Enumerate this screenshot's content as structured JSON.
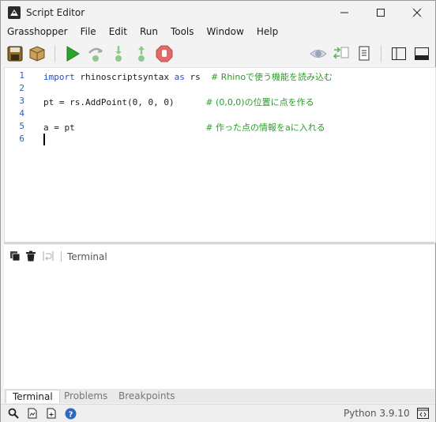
{
  "window": {
    "title": "Script Editor"
  },
  "menu": [
    "Grasshopper",
    "File",
    "Edit",
    "Run",
    "Tools",
    "Window",
    "Help"
  ],
  "editor": {
    "lines": [
      {
        "num": "1",
        "code_parts": [
          {
            "cls": "kw",
            "text": "import"
          },
          {
            "cls": "",
            "text": " rhinoscriptsyntax "
          },
          {
            "cls": "kw",
            "text": "as"
          },
          {
            "cls": "",
            "text": " rs  "
          },
          {
            "cls": "cm",
            "text": "# Rhinoで使う機能を読み込む"
          }
        ]
      },
      {
        "num": "2",
        "code_parts": []
      },
      {
        "num": "3",
        "code_parts": [
          {
            "cls": "",
            "text": "pt = rs.AddPoint(0, 0, 0)      "
          },
          {
            "cls": "cm",
            "text": "# (0,0,0)の位置に点を作る"
          }
        ]
      },
      {
        "num": "4",
        "code_parts": []
      },
      {
        "num": "5",
        "code_parts": [
          {
            "cls": "",
            "text": "a = pt                         "
          },
          {
            "cls": "cm",
            "text": "# 作った点の情報をaに入れる"
          }
        ]
      },
      {
        "num": "6",
        "code_parts": []
      }
    ]
  },
  "terminal": {
    "label": "Terminal"
  },
  "tabs": [
    {
      "label": "Terminal",
      "active": true
    },
    {
      "label": "Problems",
      "active": false
    },
    {
      "label": "Breakpoints",
      "active": false
    }
  ],
  "status": {
    "python_version": "Python 3.9.10"
  },
  "colors": {
    "run_green": "#2aa52a",
    "stop_red": "#e06a6a",
    "comment_green": "#2c9b2c",
    "keyword_blue": "#1f4bd1"
  }
}
